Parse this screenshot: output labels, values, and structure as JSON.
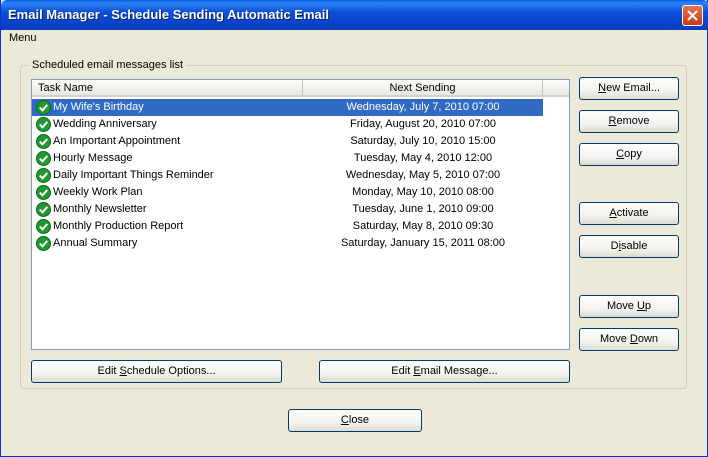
{
  "window": {
    "title": "Email Manager - Schedule Sending Automatic Email"
  },
  "menu": {
    "label": "Menu"
  },
  "group": {
    "label": "Scheduled email messages list"
  },
  "list": {
    "headers": {
      "task_name": "Task Name",
      "next_sending": "Next Sending"
    },
    "rows": [
      {
        "name": "My Wife's Birthday",
        "next": "Wednesday, July 7, 2010 07:00",
        "selected": true,
        "status_icon": "green-check-icon"
      },
      {
        "name": "Wedding Anniversary",
        "next": "Friday, August 20, 2010 07:00",
        "status_icon": "green-check-icon"
      },
      {
        "name": "An Important Appointment",
        "next": "Saturday, July 10, 2010 15:00",
        "status_icon": "green-check-icon"
      },
      {
        "name": "Hourly Message",
        "next": "Tuesday, May 4, 2010 12:00",
        "status_icon": "green-check-icon"
      },
      {
        "name": "Daily Important Things Reminder",
        "next": "Wednesday, May 5, 2010 07:00",
        "status_icon": "green-check-icon"
      },
      {
        "name": "Weekly Work Plan",
        "next": "Monday, May 10, 2010 08:00",
        "status_icon": "green-check-icon"
      },
      {
        "name": "Monthly Newsletter",
        "next": "Tuesday, June 1, 2010 09:00",
        "status_icon": "green-check-icon"
      },
      {
        "name": "Monthly Production Report",
        "next": "Saturday, May 8, 2010 09:30",
        "status_icon": "green-check-icon"
      },
      {
        "name": "Annual Summary",
        "next": "Saturday, January 15, 2011 08:00",
        "status_icon": "green-check-icon"
      }
    ]
  },
  "buttons": {
    "new_email": {
      "pre": "",
      "u": "N",
      "post": "ew Email..."
    },
    "remove": {
      "pre": "",
      "u": "R",
      "post": "emove"
    },
    "copy": {
      "pre": "",
      "u": "C",
      "post": "opy"
    },
    "activate": {
      "pre": "",
      "u": "A",
      "post": "ctivate"
    },
    "disable": {
      "pre": "D",
      "u": "i",
      "post": "sable"
    },
    "move_up": {
      "pre": "Move ",
      "u": "U",
      "post": "p"
    },
    "move_down": {
      "pre": "Move ",
      "u": "D",
      "post": "own"
    },
    "edit_schedule": {
      "pre": "Edit ",
      "u": "S",
      "post": "chedule Options..."
    },
    "edit_email": {
      "pre": "Edit ",
      "u": "E",
      "post": "mail Message..."
    },
    "close": {
      "pre": "",
      "u": "C",
      "post": "lose"
    }
  },
  "colors": {
    "title_bar": "#0a5ae8",
    "selection": "#316ac5",
    "status_check": "#1e9a2e"
  }
}
